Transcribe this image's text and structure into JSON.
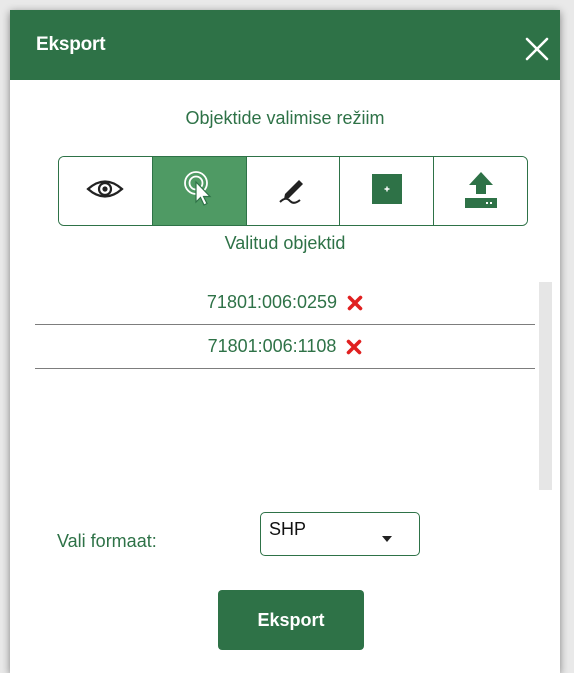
{
  "dialog": {
    "title": "Eksport",
    "close_icon": "close-icon"
  },
  "mode_section": {
    "title": "Objektide valimise režiim",
    "modes": [
      {
        "icon": "eye-icon",
        "active": false
      },
      {
        "icon": "pointer-select-icon",
        "active": true
      },
      {
        "icon": "draw-pencil-icon",
        "active": false
      },
      {
        "icon": "add-square-icon",
        "active": false
      },
      {
        "icon": "upload-icon",
        "active": false
      }
    ]
  },
  "selected": {
    "title": "Valitud objektid",
    "items": [
      {
        "code": "71801:006:0259",
        "remove_icon": "remove-x-icon"
      },
      {
        "code": "71801:006:1108",
        "remove_icon": "remove-x-icon"
      }
    ]
  },
  "format": {
    "label": "Vali formaat:",
    "value": "SHP"
  },
  "actions": {
    "export_label": "Eksport"
  },
  "colors": {
    "primary": "#2e7247",
    "active_mode": "#4f9a64",
    "remove": "#e02020"
  }
}
